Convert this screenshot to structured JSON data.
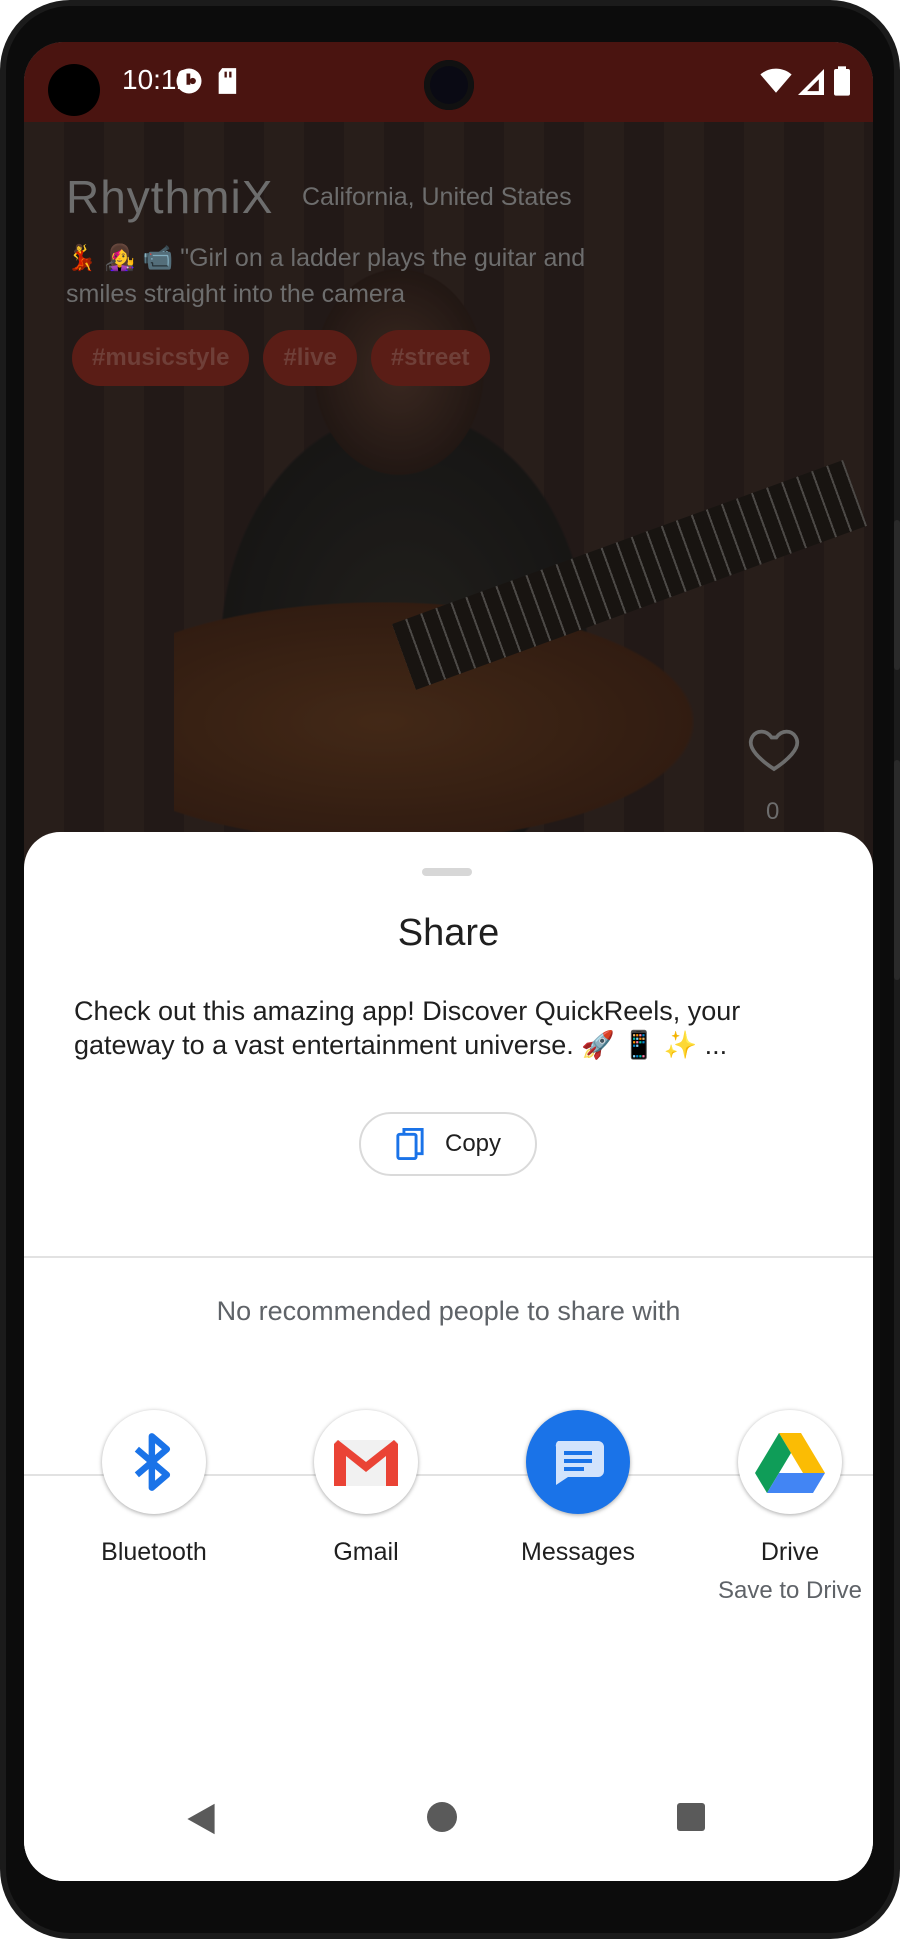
{
  "status_bar": {
    "time": "10:12",
    "icons": [
      "data-saver-icon",
      "sd-card-icon",
      "wifi-icon",
      "signal-icon",
      "battery-icon"
    ]
  },
  "reel": {
    "app_title": "RhythmiX",
    "location": "California, United States",
    "caption": "💃 👩‍🎤 📹 \"Girl on a ladder plays the guitar and smiles straight into the camera",
    "tags": [
      "#musicstyle",
      "#live",
      "#street"
    ],
    "like_count": "0"
  },
  "share_sheet": {
    "title": "Share",
    "text": "Check out this amazing app! Discover QuickReels, your gateway to a vast entertainment universe. 🚀 📱 ✨ ...",
    "copy_label": "Copy",
    "no_recommendations": "No recommended people to share with",
    "apps": [
      {
        "label": "Bluetooth",
        "sub": "",
        "icon": "bluetooth-icon"
      },
      {
        "label": "Gmail",
        "sub": "",
        "icon": "gmail-icon"
      },
      {
        "label": "Messages",
        "sub": "",
        "icon": "messages-icon"
      },
      {
        "label": "Drive",
        "sub": "Save to Drive",
        "icon": "drive-icon"
      }
    ]
  },
  "colors": {
    "status_bar": "#4a1410",
    "tag_bg": "#5a1d16",
    "bluetooth": "#1a73e8",
    "messages": "#1a73e8",
    "gmail_red": "#ea4335"
  }
}
